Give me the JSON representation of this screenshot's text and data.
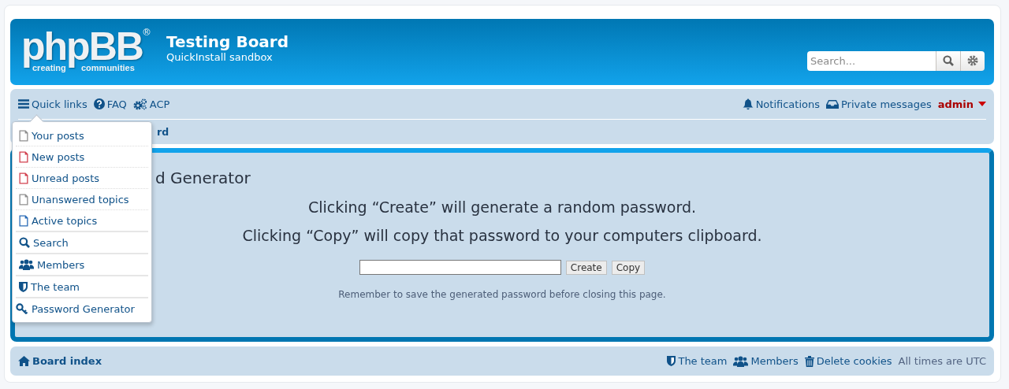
{
  "header": {
    "logo": {
      "name": "phpBB",
      "tagline_1": "creating",
      "tagline_2": "communities",
      "mark": "®"
    },
    "title": "Testing Board",
    "subtitle": "QuickInstall sandbox",
    "search": {
      "placeholder": "Search..."
    }
  },
  "navbar": {
    "left": [
      {
        "label": "Quick links",
        "kind": "menu"
      },
      {
        "label": "FAQ",
        "kind": "help"
      },
      {
        "label": "ACP",
        "kind": "gears"
      }
    ],
    "right": [
      {
        "label": "Notifications",
        "kind": "bell"
      },
      {
        "label": "Private messages",
        "kind": "inbox"
      }
    ],
    "user": "admin",
    "breadcrumb": "rd"
  },
  "quick_links_menu": [
    {
      "label": "Your posts",
      "kind": "file",
      "color": "#8f8f8f"
    },
    {
      "label": "New posts",
      "kind": "file",
      "color": "#d2404e"
    },
    {
      "label": "Unread posts",
      "kind": "file",
      "color": "#d2404e"
    },
    {
      "label": "Unanswered topics",
      "kind": "file",
      "color": "#8f8f8f"
    },
    {
      "label": "Active topics",
      "kind": "file",
      "color": "#2a6bb6"
    },
    {
      "label": "Search",
      "kind": "search"
    },
    {
      "label": "Members",
      "kind": "members"
    },
    {
      "label": "The team",
      "kind": "shield"
    },
    {
      "label": "Password Generator",
      "kind": "key"
    }
  ],
  "main": {
    "heading": "d Generator",
    "lines": [
      "Clicking “Create” will generate a random password.",
      "Clicking “Copy” will copy that password to your computers clipboard."
    ],
    "buttons": [
      "Create",
      "Copy"
    ],
    "note": "Remember to save the generated password before closing this page."
  },
  "footer": {
    "board_index": "Board index",
    "links": [
      {
        "label": "The team",
        "kind": "shield"
      },
      {
        "label": "Members",
        "kind": "members"
      },
      {
        "label": "Delete cookies",
        "kind": "trash"
      }
    ],
    "timezone": "All times are UTC"
  }
}
